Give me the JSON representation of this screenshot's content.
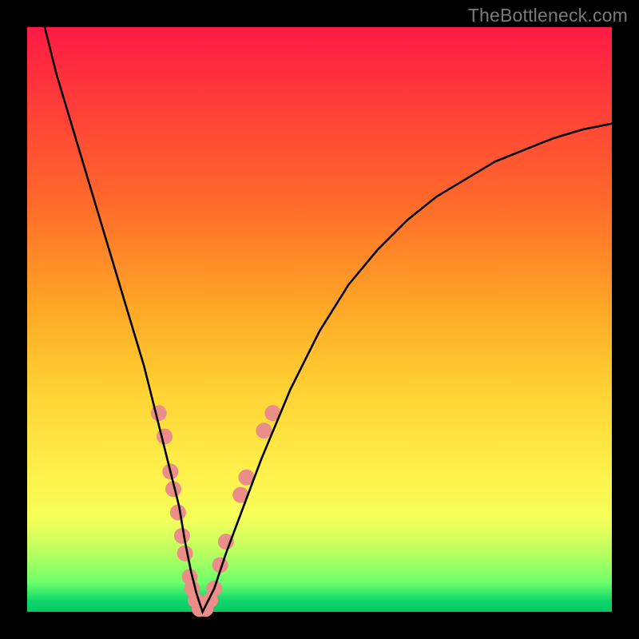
{
  "watermark": "TheBottleneck.com",
  "chart_data": {
    "type": "line",
    "title": "",
    "xlabel": "",
    "ylabel": "",
    "xlim": [
      0,
      100
    ],
    "ylim": [
      0,
      100
    ],
    "grid": false,
    "legend": false,
    "series": [
      {
        "name": "curve",
        "color": "#000000",
        "x": [
          3,
          5,
          8,
          11,
          14,
          17,
          20,
          22,
          24,
          26,
          27,
          28,
          29,
          30,
          32,
          34,
          37,
          40,
          45,
          50,
          55,
          60,
          65,
          70,
          75,
          80,
          85,
          90,
          95,
          100
        ],
        "y": [
          100,
          92,
          82,
          72,
          62,
          52,
          42,
          34,
          26,
          18,
          12,
          7,
          3,
          0,
          4,
          10,
          18,
          26,
          38,
          48,
          56,
          62,
          67,
          71,
          74,
          77,
          79,
          81,
          82.5,
          83.5
        ]
      }
    ],
    "markers": [
      {
        "name": "dots",
        "color": "#eb8d88",
        "radius": 10,
        "points": [
          {
            "x": 22.5,
            "y": 34
          },
          {
            "x": 23.5,
            "y": 30
          },
          {
            "x": 24.5,
            "y": 24
          },
          {
            "x": 25.0,
            "y": 21
          },
          {
            "x": 25.8,
            "y": 17
          },
          {
            "x": 26.5,
            "y": 13
          },
          {
            "x": 27.0,
            "y": 10
          },
          {
            "x": 27.8,
            "y": 6
          },
          {
            "x": 28.2,
            "y": 4
          },
          {
            "x": 28.8,
            "y": 2
          },
          {
            "x": 29.5,
            "y": 0.5
          },
          {
            "x": 30.5,
            "y": 0.5
          },
          {
            "x": 31.3,
            "y": 2
          },
          {
            "x": 32.0,
            "y": 4
          },
          {
            "x": 33.0,
            "y": 8
          },
          {
            "x": 34.0,
            "y": 12
          },
          {
            "x": 36.5,
            "y": 20
          },
          {
            "x": 37.5,
            "y": 23
          },
          {
            "x": 40.5,
            "y": 31
          },
          {
            "x": 42.0,
            "y": 34
          }
        ]
      }
    ]
  }
}
